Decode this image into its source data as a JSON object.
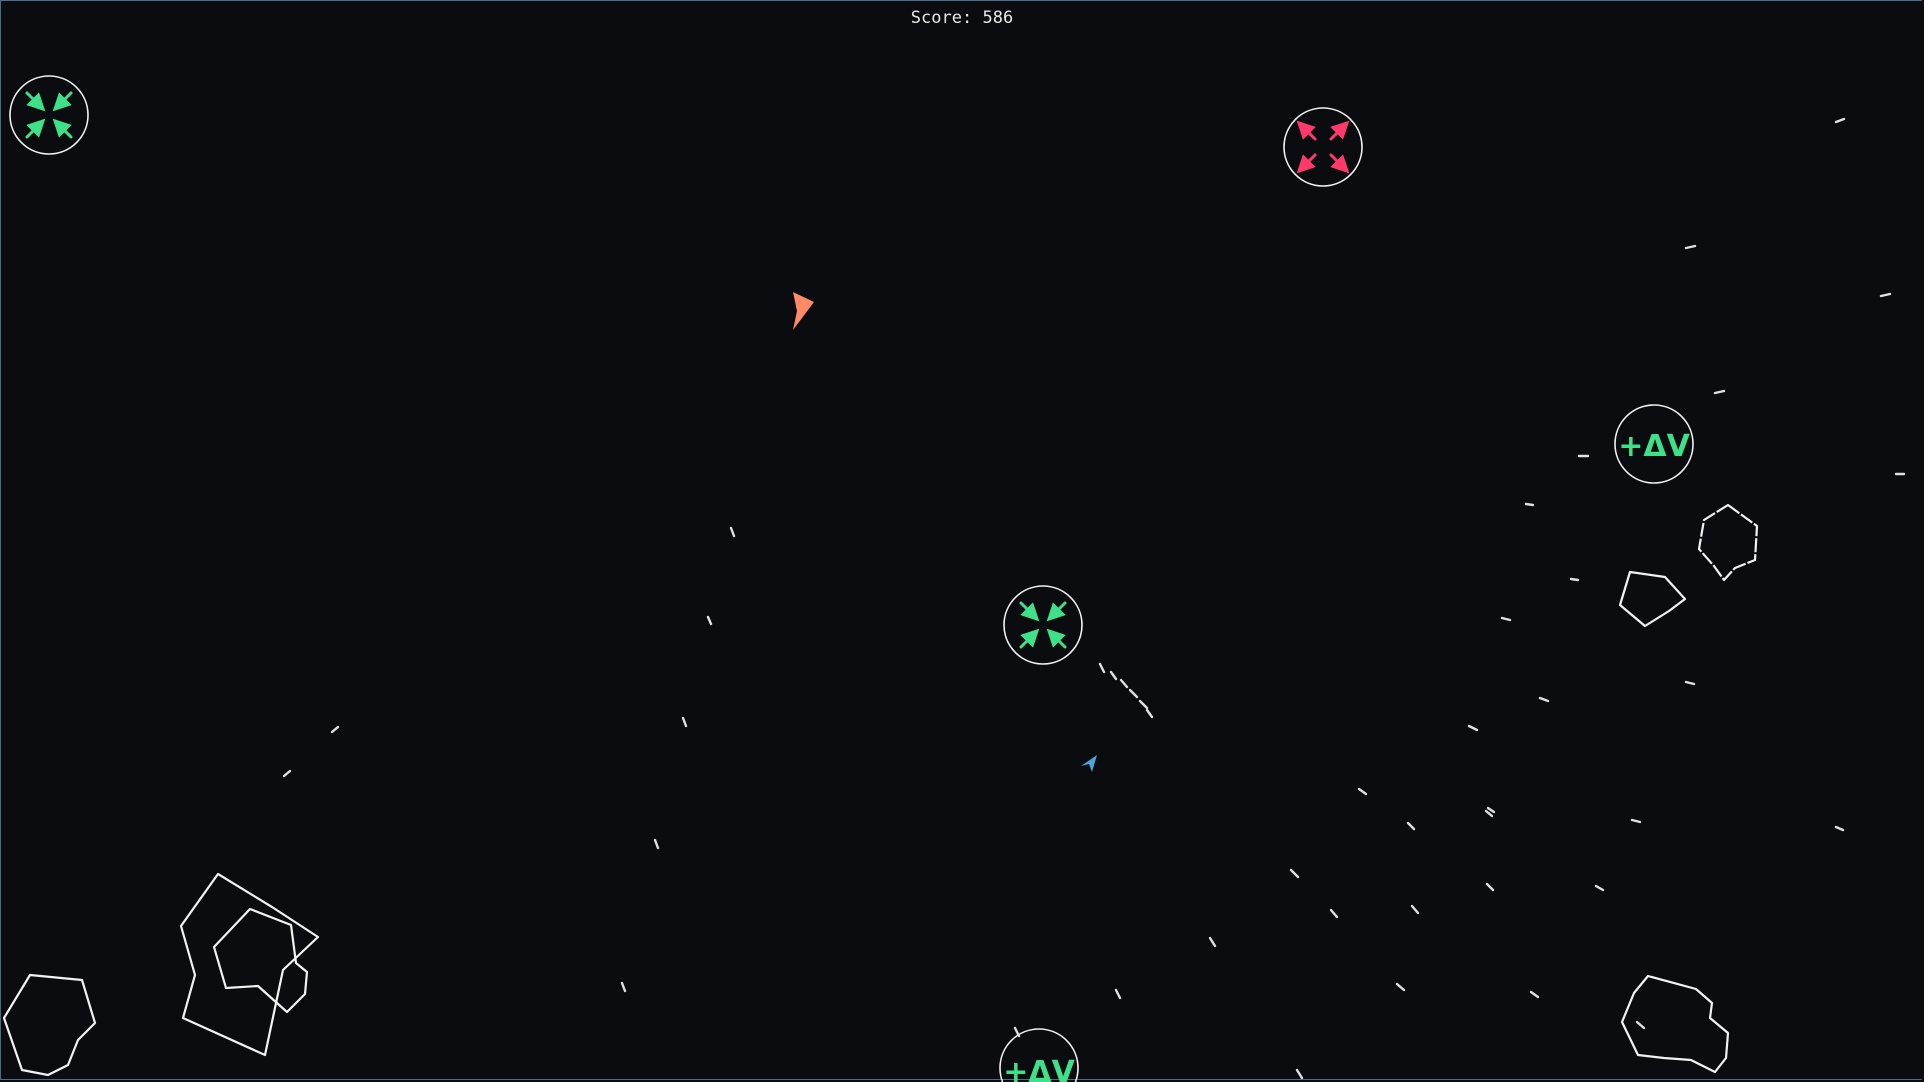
{
  "hud": {
    "score_label": "Score:",
    "score_value": "586"
  },
  "colors": {
    "background": "#0b0c0f",
    "asteroid": "#f2f2f2",
    "powerup_shrink": "#3ee08a",
    "powerup_expand": "#ff3a6a",
    "powerup_dv": "#3ee08a",
    "player_ship": "#4aa6d9",
    "enemy_ship": "#ff8a65",
    "bullet": "#e0e0e0"
  },
  "powerups": [
    {
      "kind": "shrink",
      "icon": "shrink-arrows-icon"
    },
    {
      "kind": "expand",
      "icon": "expand-arrows-icon"
    },
    {
      "kind": "delta-v",
      "label": "+ΔV"
    },
    {
      "kind": "shrink",
      "icon": "shrink-arrows-icon"
    },
    {
      "kind": "delta-v",
      "label": "+ΔV"
    }
  ]
}
